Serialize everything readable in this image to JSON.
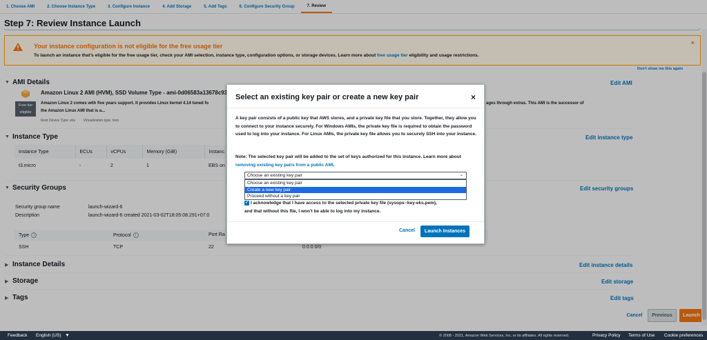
{
  "wizard": {
    "tabs": [
      "1. Choose AMI",
      "2. Choose Instance Type",
      "3. Configure Instance",
      "4. Add Storage",
      "5. Add Tags",
      "6. Configure Security Group",
      "7. Review"
    ],
    "active_tab": "7. Review"
  },
  "page": {
    "title": "Step 7: Review Instance Launch"
  },
  "warning": {
    "title": "Your instance configuration is not eligible for the free usage tier",
    "text_before": "To launch an instance that's eligible for the free usage tier, check your AMI selection, instance type, configuration options, or storage devices. Learn more about",
    "link": "free usage tier",
    "text_after": "eligibility and usage restrictions.",
    "close": "×",
    "dont_show": "Don't show me this again"
  },
  "ami": {
    "section_title": "AMI Details",
    "edit": "Edit AMI",
    "name": "Amazon Linux 2 AMI (HVM), SSD Volume Type - ami-0d06583a13678c93",
    "badge_line1": "Free tier",
    "badge_line2": "eligible",
    "desc_part1": "Amazon Linux 2 comes with five years support. It provides Linux kernel 4.14 tuned fo",
    "desc_part2": "ages through extras. This AMI is the successor of",
    "desc_line2": "the Amazon Linux AMI that is a...",
    "root_device": "Root Device Type: ebs",
    "virtualization": "Virtualization type: hvm"
  },
  "instance_type": {
    "section_title": "Instance Type",
    "edit": "Edit instance type",
    "columns": [
      "Instance Type",
      "ECUs",
      "vCPUs",
      "Memory (GiB)",
      "Instanc"
    ],
    "row": [
      "t3.micro",
      "-",
      "2",
      "1",
      "EBS on"
    ]
  },
  "security_groups": {
    "section_title": "Security Groups",
    "edit": "Edit security groups",
    "name_label": "Security group name",
    "name_value": "launch-wizard-6",
    "desc_label": "Description",
    "desc_value": "launch-wizard-6 created 2021-03-02T18:05:08.291+07:0",
    "columns": [
      "Type",
      "Protocol",
      "Port Ra"
    ],
    "row": [
      "SSH",
      "TCP",
      "22",
      "0.0.0.0/0"
    ]
  },
  "sections": {
    "instance_details": "Instance Details",
    "instance_details_edit": "Edit instance details",
    "storage": "Storage",
    "storage_edit": "Edit storage",
    "tags": "Tags",
    "tags_edit": "Edit tags"
  },
  "buttons": {
    "cancel": "Cancel",
    "previous": "Previous",
    "launch": "Launch"
  },
  "modal": {
    "title": "Select an existing key pair or create a new key pair",
    "close": "×",
    "paragraph1": "A key pair consists of a public key that AWS stores, and a private key file that you store. Together, they allow you to connect to your instance securely. For Windows AMIs, the private key file is required to obtain the password used to log into your instance. For Linux AMIs, the private key file allows you to securely SSH into your instance.",
    "note_before": "Note: The selected key pair will be added to the set of keys authorized for this instance. Learn more about",
    "note_link": "removing existing key pairs from a public AMI",
    "note_after": ".",
    "select_value": "Choose an existing key pair",
    "options": [
      "Choose an existing key pair",
      "Create a new key pair",
      "Proceed without a key pair"
    ],
    "highlighted_option": "Create a new key pair",
    "ack_line1": "I acknowledge that I have access to the selected private key file (sysops--key-eks.pem),",
    "ack_line2": "and that without this file, I won't be able to log into my instance.",
    "cancel": "Cancel",
    "launch": "Launch Instances"
  },
  "footer": {
    "feedback": "Feedback",
    "language": "English (US)",
    "copyright": "© 2008 - 2021, Amazon Web Services, Inc. or its affiliates. All rights reserved.",
    "privacy": "Privacy Policy",
    "terms": "Terms of Use",
    "cookies": "Cookie preferences"
  },
  "colors": {
    "accent_orange": "#ec7211",
    "link_blue": "#0073bb",
    "footer_bg": "#232f3e",
    "selected_option": "#1e6ae1"
  }
}
